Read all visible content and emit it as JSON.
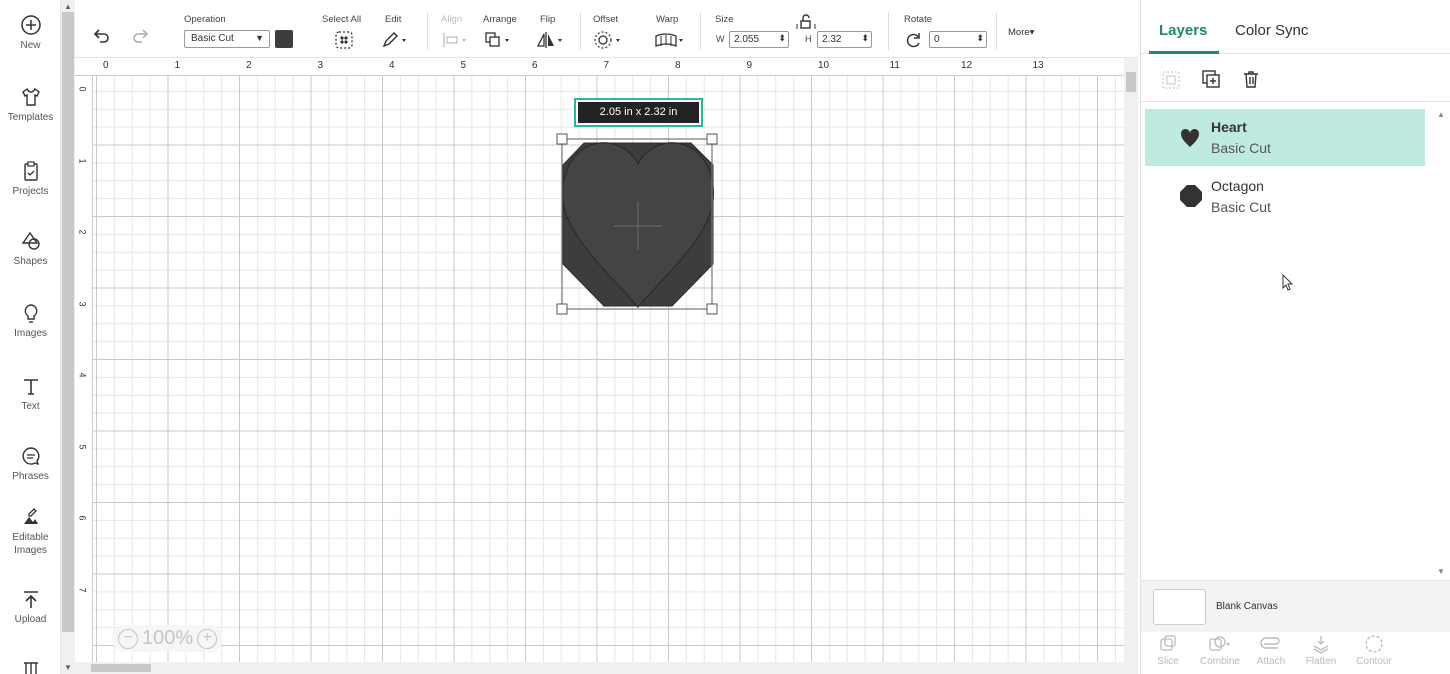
{
  "sidebar": {
    "items": [
      {
        "label": "New",
        "icon": "plus-circle-icon"
      },
      {
        "label": "Templates",
        "icon": "shirt-icon"
      },
      {
        "label": "Projects",
        "icon": "clipboard-icon"
      },
      {
        "label": "Shapes",
        "icon": "shapes-icon"
      },
      {
        "label": "Images",
        "icon": "lightbulb-icon"
      },
      {
        "label": "Text",
        "icon": "text-icon"
      },
      {
        "label": "Phrases",
        "icon": "speech-bubble-icon"
      },
      {
        "label": "Editable Images",
        "icon": "editable-image-icon"
      },
      {
        "label": "Upload",
        "icon": "upload-icon"
      }
    ]
  },
  "toolbar": {
    "operation_label": "Operation",
    "operation_value": "Basic Cut",
    "select_all_label": "Select All",
    "edit_label": "Edit",
    "align_label": "Align",
    "arrange_label": "Arrange",
    "flip_label": "Flip",
    "offset_label": "Offset",
    "warp_label": "Warp",
    "size_label": "Size",
    "width_label": "W",
    "width_value": "2.055",
    "height_label": "H",
    "height_value": "2.32",
    "rotate_label": "Rotate",
    "rotate_value": "0",
    "more_label": "More"
  },
  "canvas": {
    "ruler_top": [
      "0",
      "1",
      "2",
      "3",
      "4",
      "5",
      "6",
      "7",
      "8",
      "9",
      "10",
      "11",
      "12",
      "13"
    ],
    "ruler_left": [
      "0",
      "1",
      "2",
      "3",
      "4",
      "5",
      "6",
      "7"
    ],
    "dimension_tag": "2.05  in x 2.32  in",
    "zoom": "100%",
    "object_color": "#3d3d3d"
  },
  "panel": {
    "tabs": [
      "Layers",
      "Color Sync"
    ],
    "layers": [
      {
        "name": "Heart",
        "operation": "Basic Cut"
      },
      {
        "name": "Octagon",
        "operation": "Basic Cut"
      }
    ],
    "blank_canvas_label": "Blank Canvas",
    "bottom_actions": [
      "Slice",
      "Combine",
      "Attach",
      "Flatten",
      "Contour"
    ]
  },
  "colors": {
    "accent": "#1d8a71",
    "selected_layer_bg": "#bfeadf"
  }
}
